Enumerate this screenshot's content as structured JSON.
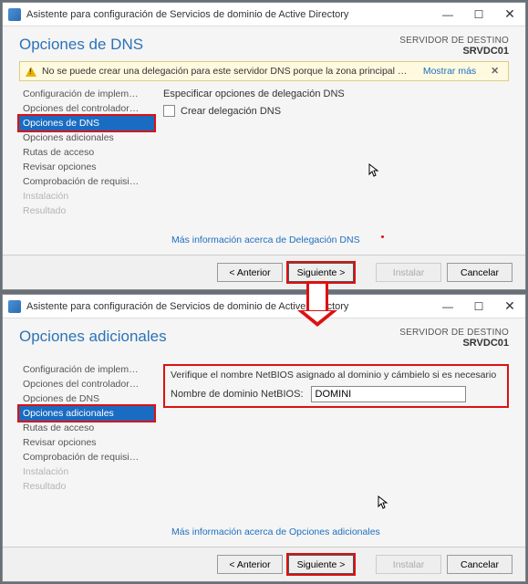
{
  "window1": {
    "title": "Asistente para configuración de Servicios de dominio de Active Directory",
    "page_title": "Opciones de DNS",
    "dest_label": "SERVIDOR DE DESTINO",
    "dest_server": "SRVDC01",
    "warning_text": "No se puede crear una delegación para este servidor DNS porque la zona principal autoritativa no se encu…",
    "show_more": "Mostrar más",
    "sidebar": {
      "items": [
        {
          "label": "Configuración de implem…"
        },
        {
          "label": "Opciones del controlador…"
        },
        {
          "label": "Opciones de DNS"
        },
        {
          "label": "Opciones adicionales"
        },
        {
          "label": "Rutas de acceso"
        },
        {
          "label": "Revisar opciones"
        },
        {
          "label": "Comprobación de requisi…"
        },
        {
          "label": "Instalación"
        },
        {
          "label": "Resultado"
        }
      ]
    },
    "main": {
      "heading": "Especificar opciones de delegación DNS",
      "checkbox_label": "Crear delegación DNS"
    },
    "info_link": "Más información acerca de Delegación DNS",
    "buttons": {
      "prev": "< Anterior",
      "next": "Siguiente >",
      "install": "Instalar",
      "cancel": "Cancelar"
    }
  },
  "window2": {
    "title": "Asistente para configuración de Servicios de dominio de Active Directory",
    "page_title": "Opciones adicionales",
    "dest_label": "SERVIDOR DE DESTINO",
    "dest_server": "SRVDC01",
    "sidebar": {
      "items": [
        {
          "label": "Configuración de implem…"
        },
        {
          "label": "Opciones del controlador…"
        },
        {
          "label": "Opciones de DNS"
        },
        {
          "label": "Opciones adicionales"
        },
        {
          "label": "Rutas de acceso"
        },
        {
          "label": "Revisar opciones"
        },
        {
          "label": "Comprobación de requisi…"
        },
        {
          "label": "Instalación"
        },
        {
          "label": "Resultado"
        }
      ]
    },
    "main": {
      "verify_text": "Verifique el nombre NetBIOS asignado al dominio y cámbielo si es necesario",
      "field_label": "Nombre de dominio NetBIOS:",
      "field_value": "DOMINI"
    },
    "info_link": "Más información acerca de Opciones adicionales",
    "buttons": {
      "prev": "< Anterior",
      "next": "Siguiente >",
      "install": "Instalar",
      "cancel": "Cancelar"
    }
  }
}
